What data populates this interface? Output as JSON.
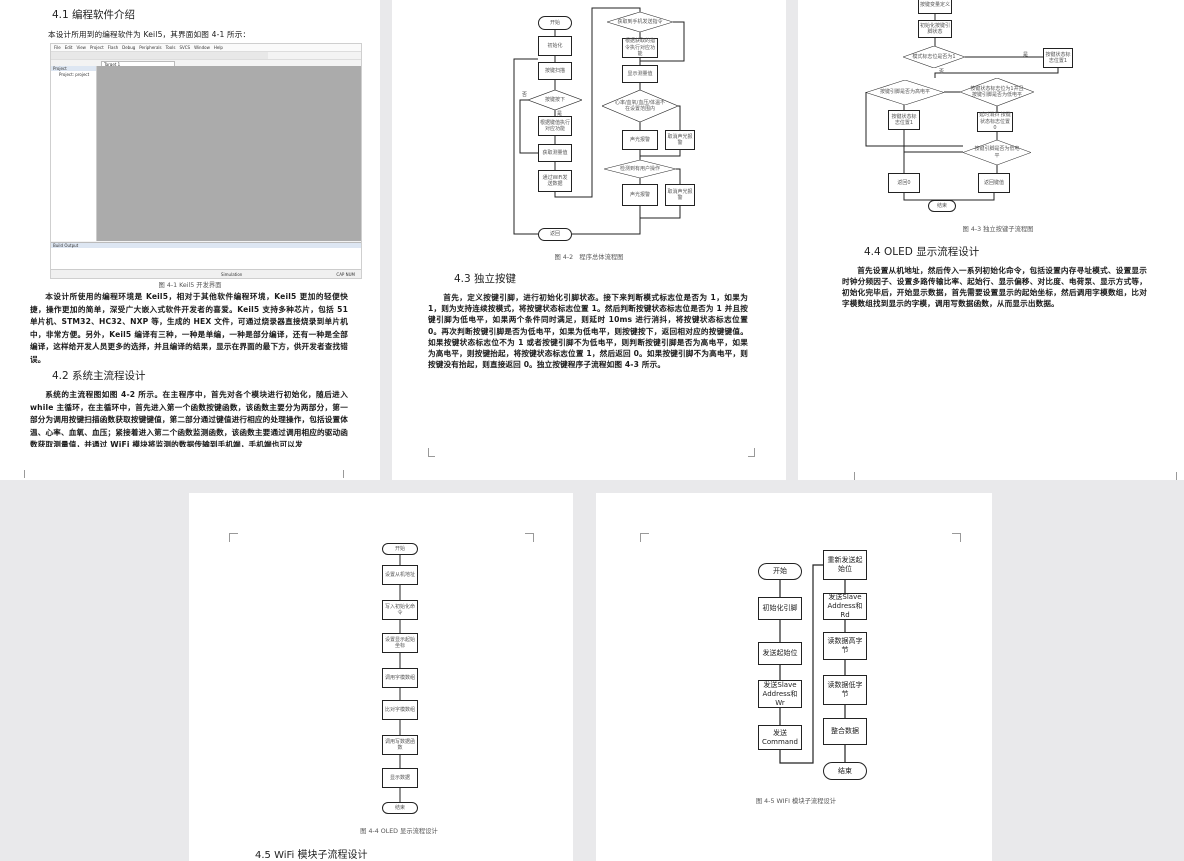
{
  "page1": {
    "heading_41": "4.1 编程软件介绍",
    "intro": "本设计所用到的编程软件为 Keil5，其界面如图 4-1 所示：",
    "keil": {
      "menu": [
        "File",
        "Edit",
        "View",
        "Project",
        "Flash",
        "Debug",
        "Peripherals",
        "Tools",
        "SVCS",
        "Window",
        "Help"
      ],
      "target": "Target 1",
      "project_pane": "Project",
      "project_item": "Project: project",
      "build_output": "Build Output",
      "status_sim": "Simulation",
      "status_cap": "CAP NUM"
    },
    "fig1_caption": "图 4-1 Keil5 开发界面",
    "para1": "本设计所使用的编程环境是 Keil5，相对于其他软件编程环境，Keil5 更加的轻便快捷，操作更加的简单，深受广大嵌入式软件开发者的喜爱。Keil5 支持多种芯片，包括 51 单片机、STM32、HC32、NXP 等，生成的 HEX 文件，可通过烧录器直接烧录到单片机中，非常方便。另外，Keil5 编译有三种，一种是单编，一种是部分编译，还有一种是全部编译，这样给开发人员更多的选择，并且编译的结果，显示在界面的最下方，供开发者查找错误。",
    "heading_42": "4.2 系统主流程设计",
    "para2": "系统的主流程图如图 4-2 所示。在主程序中，首先对各个模块进行初始化，随后进入 while 主循环，在主循环中，首先进入第一个函数按键函数，该函数主要分为两部分，第一部分为调用按键扫描函数获取按键键值，第二部分通过键值进行相应的处理操作，包括设置体温、心率、血氧、血压；紧接着进入第二个函数监测函数，该函数主要通过调用相应的驱动函数获取测量值，并通过 WiFi 模块将监测的数据传输到手机端，手机端也可以发"
  },
  "page2": {
    "flow": {
      "start": "开始",
      "init": "初始化",
      "scan": "按键扫描",
      "pressed": "按键按下",
      "exec_key": "根据键值执行对应功能",
      "measure": "获取测量值",
      "wifi": "通过WiFi发送数据",
      "ret": "返回",
      "phone_cmd": "获取到手机发送指令",
      "exec_cmd": "根据获取的指令执行对应功能",
      "display": "显示测量值",
      "range": "心率/血氧/血压/体温不在设置范围内",
      "alarm1": "声光报警",
      "cancel1": "取消声光报警",
      "user_op": "检测到有用户操作",
      "alarm2": "声光报警",
      "cancel2": "取消声光报警",
      "yes": "是",
      "no": "否"
    },
    "fig2_caption": "图 4-2　程序总体流程图",
    "heading_43": "4.3 独立按键",
    "para3": "首先，定义按键引脚，进行初始化引脚状态。接下来判断模式标志位是否为 1，如果为 1，则为支持连续按模式，将按键状态标志位置 1。然后判断按键状态标志位是否为 1 并且按键引脚为低电平，如果两个条件同时满足，则延时 10ms 进行消抖，将按键状态标志位置 0。再次判断按键引脚是否为低电平，如果为低电平，则按键按下，返回相对应的按键键值。如果按键状态标志位不为 1 或者按键引脚不为低电平，则判断按键引脚是否为高电平，如果为高电平，则按键抬起，将按键状态标志位置 1，然后返回 0。如果按键引脚不为高电平，则按键没有抬起，则直接返回 0。独立按键程序子流程如图 4-3 所示。"
  },
  "page3": {
    "flow": {
      "define": "按键变量定义",
      "init": "初始化按键引脚状态",
      "mode": "模式标志位是否为1",
      "set1a": "按键状态标志位置1",
      "high": "按键引脚是否为高电平",
      "cond": "按键状态标志位为1并且按键引脚是否为低电平",
      "set1b": "按键状态标志位置1",
      "debounce": "延时消抖 按键状态标志位置0",
      "low": "按键引脚是否为低电平",
      "ret0": "返回0",
      "retkey": "返回键值",
      "end": "结束",
      "yes": "是",
      "no": "否"
    },
    "fig3_caption": "图 4-3 独立按键子流程图",
    "heading_44": "4.4 OLED 显示流程设计",
    "para4": "首先设置从机地址，然后传入一系列初始化命令，包括设置内存寻址模式、设置显示时钟分频因子、设置多路传输比率、起始行、显示偏移、对比度、电荷泵、显示方式等，初始化完毕后，开始显示数据，首先需要设置显示的起始坐标，然后调用字模数组，比对字模数组找到显示的字模，调用写数据函数，从而显示出数据。"
  },
  "page4": {
    "flow": [
      "开始",
      "设置从机地址",
      "写入初始化命令",
      "设置显示起始坐标",
      "调用字模数组",
      "比对字模数组",
      "调用写数据函数",
      "显示数据",
      "结束"
    ],
    "fig4_caption": "图 4-4 OLED 显示流程设计",
    "heading_45": "4.5 WiFi 模块子流程设计"
  },
  "page5": {
    "flow": {
      "start": "开始",
      "init": "初始化引脚",
      "startbit": "发送起始位",
      "slave_wr": "发送Slave Address和Wr",
      "command": "发送Command",
      "restart": "重新发送起始位",
      "slave_rd": "发送Slave Address和Rd",
      "high": "读数据高字节",
      "low": "读数据低字节",
      "merge": "整合数据",
      "end": "结束"
    },
    "fig5_caption": "图 4-5 WIFI 模块子流程设计"
  }
}
